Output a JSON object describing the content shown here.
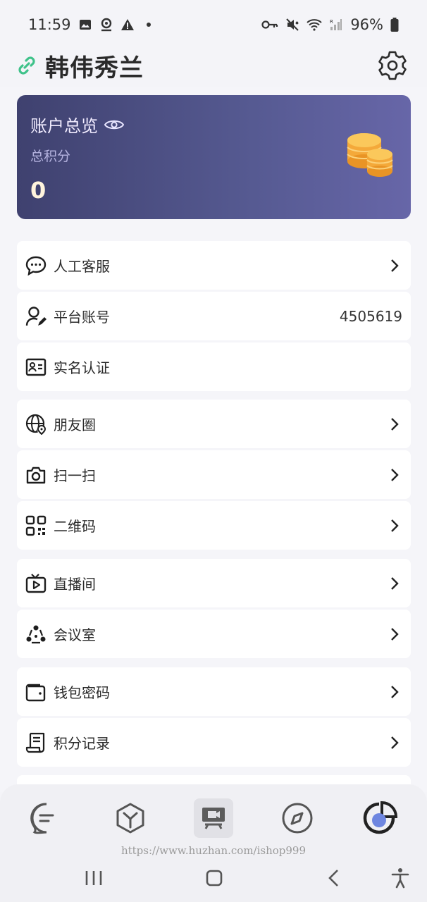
{
  "status_bar": {
    "time": "11:59",
    "battery": "96%",
    "icons": [
      "image-icon",
      "location-icon",
      "warning-icon",
      "dot-icon",
      "vpn-key-icon",
      "mute-icon",
      "wifi-icon",
      "signal-icon",
      "battery-icon"
    ]
  },
  "header": {
    "title": "韩伟秀兰",
    "left_icon": "link-icon",
    "right_icon": "gear-icon"
  },
  "account": {
    "title": "账户总览",
    "subtitle": "总积分",
    "value": "0",
    "icons": [
      "eye-icon",
      "coins-icon"
    ]
  },
  "menu": [
    {
      "label": "人工客服",
      "icon": "chat-bubble-icon",
      "chevron": true
    },
    {
      "label": "平台账号",
      "icon": "user-edit-icon",
      "value": "4505619"
    },
    {
      "label": "实名认证",
      "icon": "id-card-icon"
    },
    {
      "label": "朋友圈",
      "icon": "globe-pin-icon",
      "chevron": true
    },
    {
      "label": "扫一扫",
      "icon": "camera-icon",
      "chevron": true
    },
    {
      "label": "二维码",
      "icon": "qr-code-icon",
      "chevron": true
    },
    {
      "label": "直播间",
      "icon": "tv-play-icon",
      "chevron": true
    },
    {
      "label": "会议室",
      "icon": "meeting-icon",
      "chevron": true
    },
    {
      "label": "钱包密码",
      "icon": "wallet-icon",
      "chevron": true
    },
    {
      "label": "积分记录",
      "icon": "scroll-icon",
      "chevron": true
    }
  ],
  "bottom_nav": {
    "tabs": [
      "message-tab-icon",
      "cube-tab-icon",
      "presentation-tab-icon",
      "compass-tab-icon",
      "pie-chart-tab-icon"
    ],
    "active_index": 4,
    "watermark": "https://www.huzhan.com/ishop999"
  },
  "system_nav": [
    "recents-icon",
    "home-icon",
    "back-icon",
    "accessibility-icon"
  ],
  "colors": {
    "card_gradient_start": "#3f416f",
    "card_gradient_end": "#6766a8",
    "link_icon": "#3fc28a",
    "coin": "#f4a93a",
    "active_tab_dot": "#6e86e0"
  }
}
